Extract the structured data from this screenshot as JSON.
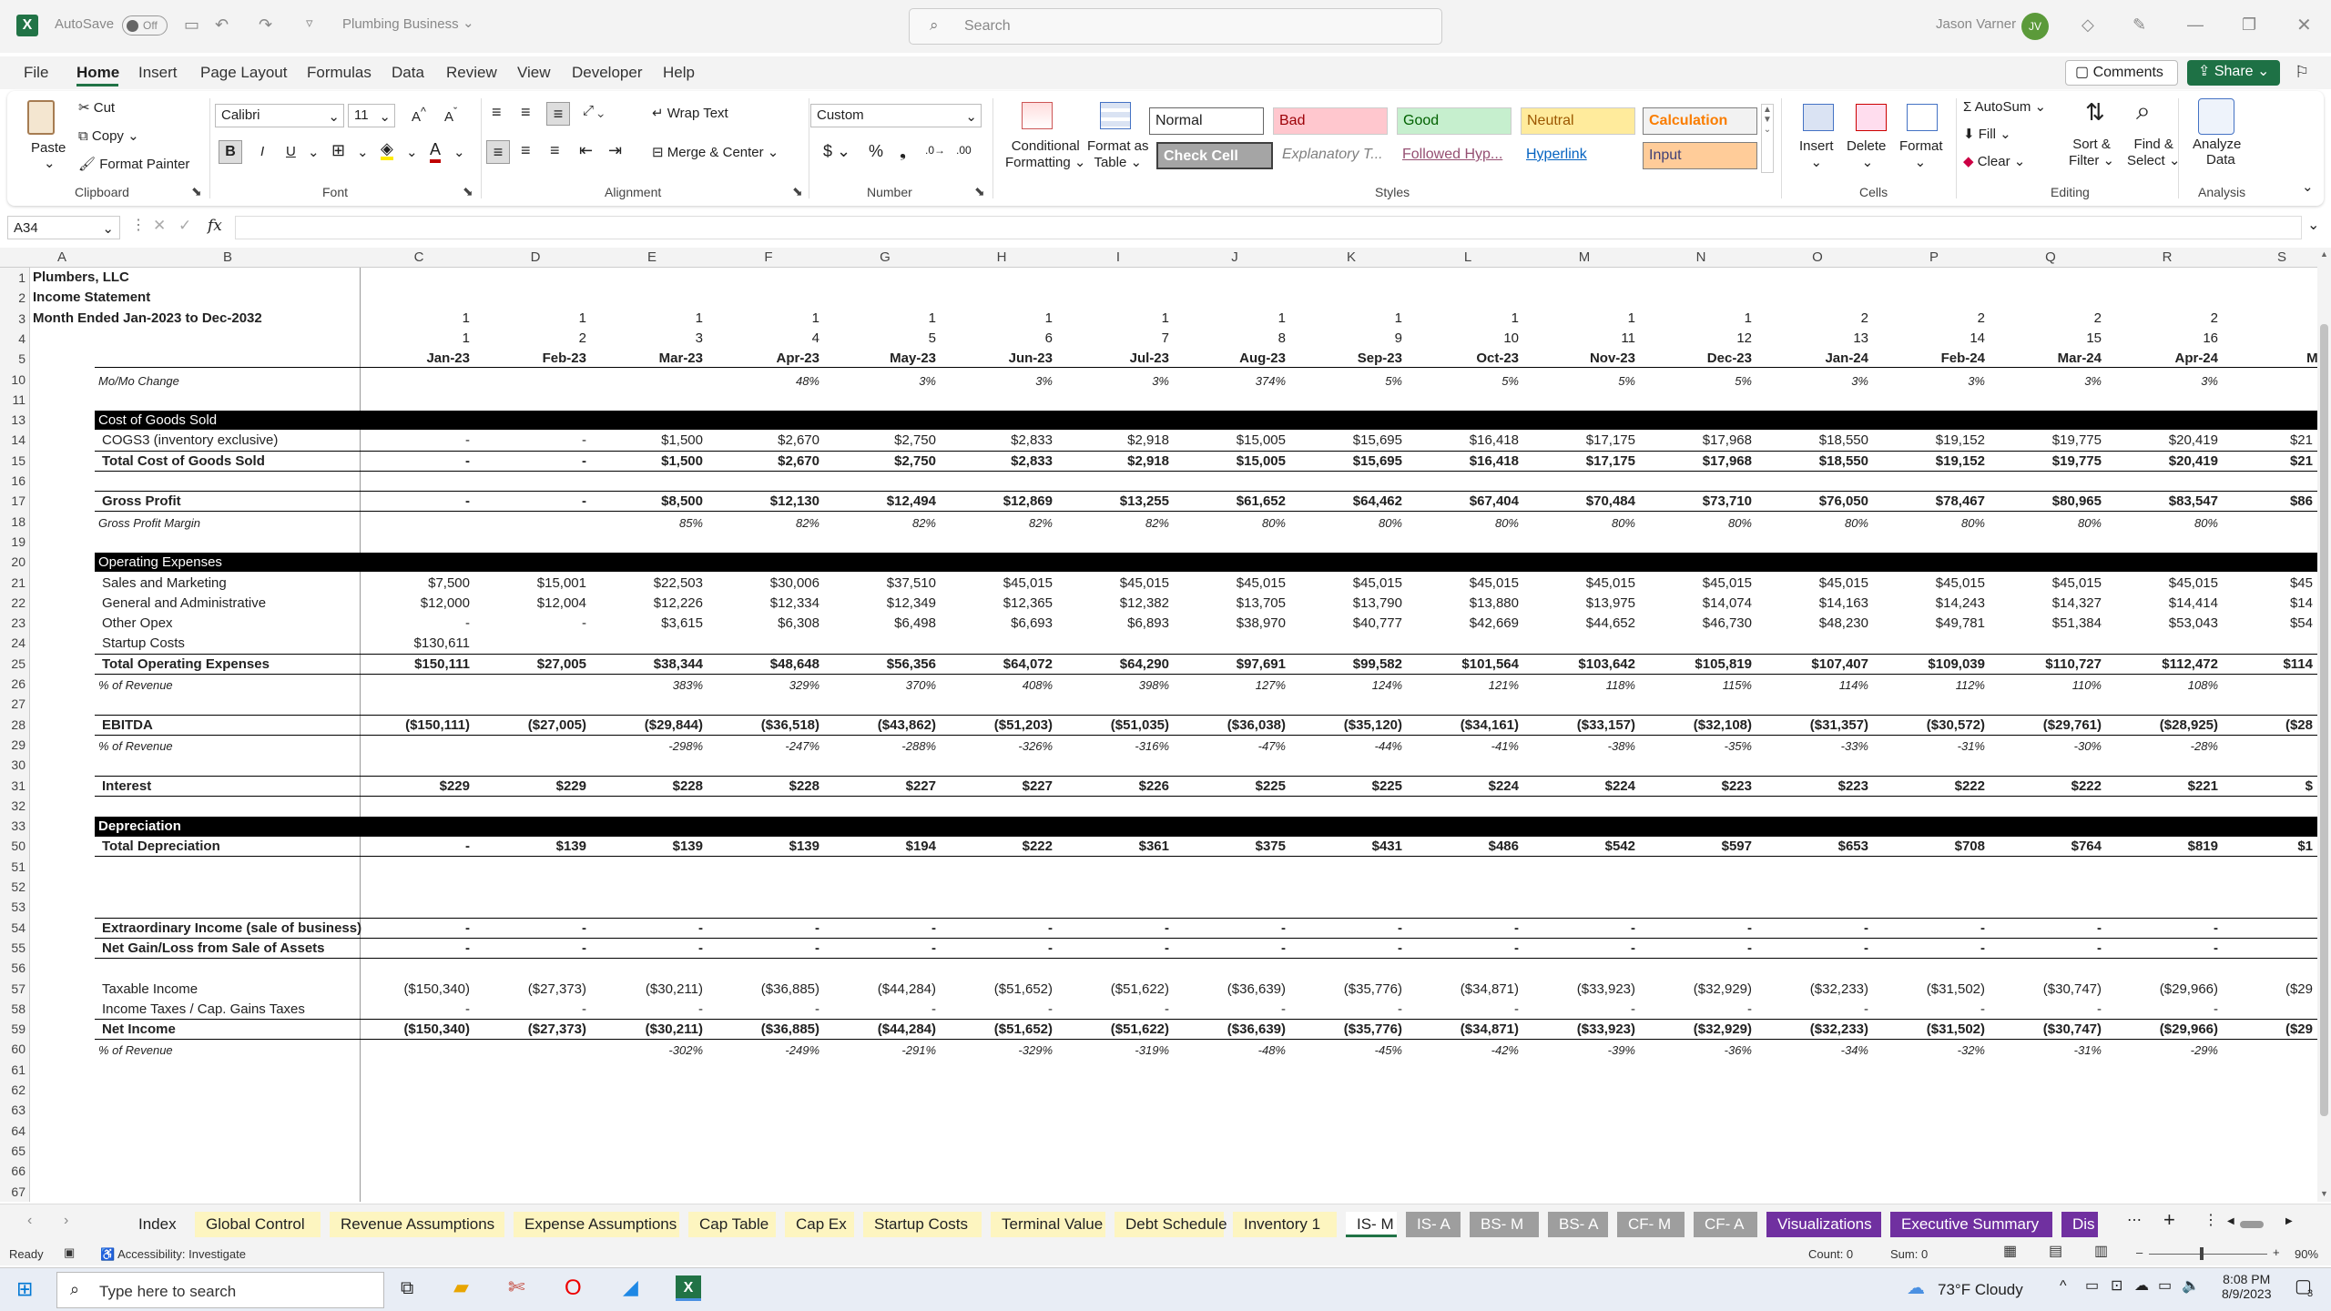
{
  "titlebar": {
    "autosave": "AutoSave",
    "autosave_state": "Off",
    "file_name": "Plumbing Business",
    "search_placeholder": "Search",
    "user": "Jason Varner",
    "initials": "JV"
  },
  "menu": [
    "File",
    "Home",
    "Insert",
    "Page Layout",
    "Formulas",
    "Data",
    "Review",
    "View",
    "Developer",
    "Help"
  ],
  "menu_buttons": {
    "comments": "Comments",
    "share": "Share"
  },
  "ribbon": {
    "clipboard": {
      "paste": "Paste",
      "cut": "Cut",
      "copy": "Copy",
      "format_painter": "Format Painter",
      "group": "Clipboard"
    },
    "font": {
      "name": "Calibri",
      "size": "11",
      "group": "Font"
    },
    "alignment": {
      "wrap": "Wrap Text",
      "merge": "Merge & Center",
      "group": "Alignment"
    },
    "number": {
      "format": "Custom",
      "group": "Number"
    },
    "styles": {
      "cond": "Conditional",
      "cond2": "Formatting",
      "fmt_table": "Format as",
      "fmt_table2": "Table",
      "group": "Styles",
      "cells": [
        "Normal",
        "Bad",
        "Good",
        "Neutral",
        "Calculation",
        "Check Cell",
        "Explanatory T...",
        "Followed Hyp...",
        "Hyperlink",
        "Input"
      ]
    },
    "cells": {
      "insert": "Insert",
      "delete": "Delete",
      "format": "Format",
      "group": "Cells"
    },
    "editing": {
      "autosum": "AutoSum",
      "fill": "Fill",
      "clear": "Clear",
      "sort": "Sort &",
      "sort2": "Filter",
      "find": "Find &",
      "find2": "Select",
      "group": "Editing"
    },
    "analysis": {
      "analyze": "Analyze",
      "analyze2": "Data",
      "group": "Analysis"
    }
  },
  "formula_bar": {
    "name_box": "A34",
    "fx": "fx",
    "formula": ""
  },
  "columns": [
    "A",
    "B",
    "C",
    "D",
    "E",
    "F",
    "G",
    "H",
    "I",
    "J",
    "K",
    "L",
    "M",
    "N",
    "O",
    "P",
    "Q",
    "R",
    "S"
  ],
  "row_numbers": [
    "1",
    "2",
    "3",
    "4",
    "5",
    "10",
    "11",
    "13",
    "14",
    "15",
    "16",
    "17",
    "18",
    "19",
    "20",
    "21",
    "22",
    "23",
    "24",
    "25",
    "26",
    "27",
    "28",
    "29",
    "30",
    "31",
    "32",
    "33",
    "50",
    "51",
    "52",
    "53",
    "54",
    "55",
    "56",
    "57",
    "58",
    "59",
    "60",
    "61",
    "62",
    "63",
    "64",
    "65",
    "66",
    "67"
  ],
  "sheet": {
    "a1": "Plumbers, LLC",
    "a2": "Income Statement",
    "a3": "Month Ended Jan-2023 to Dec-2032",
    "row3": [
      "1",
      "1",
      "1",
      "1",
      "1",
      "1",
      "1",
      "1",
      "1",
      "1",
      "1",
      "1",
      "2",
      "2",
      "2",
      "2"
    ],
    "row4": [
      "1",
      "2",
      "3",
      "4",
      "5",
      "6",
      "7",
      "8",
      "9",
      "10",
      "11",
      "12",
      "13",
      "14",
      "15",
      "16"
    ],
    "months": [
      "Jan-23",
      "Feb-23",
      "Mar-23",
      "Apr-23",
      "May-23",
      "Jun-23",
      "Jul-23",
      "Aug-23",
      "Sep-23",
      "Oct-23",
      "Nov-23",
      "Dec-23",
      "Jan-24",
      "Feb-24",
      "Mar-24",
      "Apr-24",
      "Ma"
    ],
    "rows": [
      {
        "r": "10",
        "label": "Mo/Mo Change",
        "style": "i",
        "vals": [
          "",
          "",
          "",
          "48%",
          "3%",
          "3%",
          "3%",
          "374%",
          "5%",
          "5%",
          "5%",
          "5%",
          "3%",
          "3%",
          "3%",
          "3%",
          ""
        ]
      },
      {
        "r": "13",
        "label": "Cost of Goods Sold",
        "style": "hdr",
        "vals": []
      },
      {
        "r": "14",
        "label": "COGS3 (inventory exclusive)",
        "style": "n",
        "vals": [
          "-",
          "-",
          "$1,500",
          "$2,670",
          "$2,750",
          "$2,833",
          "$2,918",
          "$15,005",
          "$15,695",
          "$16,418",
          "$17,175",
          "$17,968",
          "$18,550",
          "$19,152",
          "$19,775",
          "$20,419",
          "$21"
        ]
      },
      {
        "r": "15",
        "label": "Total Cost of Goods Sold",
        "style": "b",
        "vals": [
          "-",
          "-",
          "$1,500",
          "$2,670",
          "$2,750",
          "$2,833",
          "$2,918",
          "$15,005",
          "$15,695",
          "$16,418",
          "$17,175",
          "$17,968",
          "$18,550",
          "$19,152",
          "$19,775",
          "$20,419",
          "$21"
        ]
      },
      {
        "r": "17",
        "label": "Gross Profit",
        "style": "b",
        "vals": [
          "-",
          "-",
          "$8,500",
          "$12,130",
          "$12,494",
          "$12,869",
          "$13,255",
          "$61,652",
          "$64,462",
          "$67,404",
          "$70,484",
          "$73,710",
          "$76,050",
          "$78,467",
          "$80,965",
          "$83,547",
          "$86"
        ]
      },
      {
        "r": "18",
        "label": "Gross Profit Margin",
        "style": "i",
        "vals": [
          "",
          "",
          "85%",
          "82%",
          "82%",
          "82%",
          "82%",
          "80%",
          "80%",
          "80%",
          "80%",
          "80%",
          "80%",
          "80%",
          "80%",
          "80%",
          ""
        ]
      },
      {
        "r": "20",
        "label": "Operating Expenses",
        "style": "hdr",
        "vals": []
      },
      {
        "r": "21",
        "label": "Sales and Marketing",
        "style": "n",
        "vals": [
          "$7,500",
          "$15,001",
          "$22,503",
          "$30,006",
          "$37,510",
          "$45,015",
          "$45,015",
          "$45,015",
          "$45,015",
          "$45,015",
          "$45,015",
          "$45,015",
          "$45,015",
          "$45,015",
          "$45,015",
          "$45,015",
          "$45"
        ]
      },
      {
        "r": "22",
        "label": "General and Administrative",
        "style": "n",
        "vals": [
          "$12,000",
          "$12,004",
          "$12,226",
          "$12,334",
          "$12,349",
          "$12,365",
          "$12,382",
          "$13,705",
          "$13,790",
          "$13,880",
          "$13,975",
          "$14,074",
          "$14,163",
          "$14,243",
          "$14,327",
          "$14,414",
          "$14"
        ]
      },
      {
        "r": "23",
        "label": "Other Opex",
        "style": "n",
        "vals": [
          "-",
          "-",
          "$3,615",
          "$6,308",
          "$6,498",
          "$6,693",
          "$6,893",
          "$38,970",
          "$40,777",
          "$42,669",
          "$44,652",
          "$46,730",
          "$48,230",
          "$49,781",
          "$51,384",
          "$53,043",
          "$54"
        ]
      },
      {
        "r": "24",
        "label": "Startup Costs",
        "style": "n",
        "vals": [
          "$130,611",
          "",
          "",
          "",
          "",
          "",
          "",
          "",
          "",
          "",
          "",
          "",
          "",
          "",
          "",
          "",
          ""
        ]
      },
      {
        "r": "25",
        "label": "Total Operating Expenses",
        "style": "b",
        "vals": [
          "$150,111",
          "$27,005",
          "$38,344",
          "$48,648",
          "$56,356",
          "$64,072",
          "$64,290",
          "$97,691",
          "$99,582",
          "$101,564",
          "$103,642",
          "$105,819",
          "$107,407",
          "$109,039",
          "$110,727",
          "$112,472",
          "$114"
        ]
      },
      {
        "r": "26",
        "label": "% of Revenue",
        "style": "i",
        "vals": [
          "",
          "",
          "383%",
          "329%",
          "370%",
          "408%",
          "398%",
          "127%",
          "124%",
          "121%",
          "118%",
          "115%",
          "114%",
          "112%",
          "110%",
          "108%",
          ""
        ]
      },
      {
        "r": "28",
        "label": "EBITDA",
        "style": "b",
        "vals": [
          "($150,111)",
          "($27,005)",
          "($29,844)",
          "($36,518)",
          "($43,862)",
          "($51,203)",
          "($51,035)",
          "($36,038)",
          "($35,120)",
          "($34,161)",
          "($33,157)",
          "($32,108)",
          "($31,357)",
          "($30,572)",
          "($29,761)",
          "($28,925)",
          "($28"
        ]
      },
      {
        "r": "29",
        "label": "% of Revenue",
        "style": "i",
        "vals": [
          "",
          "",
          "-298%",
          "-247%",
          "-288%",
          "-326%",
          "-316%",
          "-47%",
          "-44%",
          "-41%",
          "-38%",
          "-35%",
          "-33%",
          "-31%",
          "-30%",
          "-28%",
          ""
        ]
      },
      {
        "r": "31",
        "label": "Interest",
        "style": "b",
        "vals": [
          "$229",
          "$229",
          "$228",
          "$228",
          "$227",
          "$227",
          "$226",
          "$225",
          "$225",
          "$224",
          "$224",
          "$223",
          "$223",
          "$222",
          "$222",
          "$221",
          "$"
        ]
      },
      {
        "r": "33",
        "label": "Depreciation",
        "style": "hdr",
        "vals": []
      },
      {
        "r": "50",
        "label": "Total Depreciation",
        "style": "b",
        "vals": [
          "-",
          "$139",
          "$139",
          "$139",
          "$194",
          "$222",
          "$361",
          "$375",
          "$431",
          "$486",
          "$542",
          "$597",
          "$653",
          "$708",
          "$764",
          "$819",
          "$1"
        ]
      },
      {
        "r": "54",
        "label": "Extraordinary Income (sale of business)",
        "style": "b",
        "vals": [
          "-",
          "-",
          "-",
          "-",
          "-",
          "-",
          "-",
          "-",
          "-",
          "-",
          "-",
          "-",
          "-",
          "-",
          "-",
          "-",
          ""
        ]
      },
      {
        "r": "55",
        "label": "Net Gain/Loss from Sale of Assets",
        "style": "b",
        "vals": [
          "-",
          "-",
          "-",
          "-",
          "-",
          "-",
          "-",
          "-",
          "-",
          "-",
          "-",
          "-",
          "-",
          "-",
          "-",
          "-",
          ""
        ]
      },
      {
        "r": "57",
        "label": "Taxable Income",
        "style": "n",
        "vals": [
          "($150,340)",
          "($27,373)",
          "($30,211)",
          "($36,885)",
          "($44,284)",
          "($51,652)",
          "($51,622)",
          "($36,639)",
          "($35,776)",
          "($34,871)",
          "($33,923)",
          "($32,929)",
          "($32,233)",
          "($31,502)",
          "($30,747)",
          "($29,966)",
          "($29"
        ]
      },
      {
        "r": "58",
        "label": "Income Taxes / Cap. Gains Taxes",
        "style": "n",
        "vals": [
          "-",
          "-",
          "-",
          "-",
          "-",
          "-",
          "-",
          "-",
          "-",
          "-",
          "-",
          "-",
          "-",
          "-",
          "-",
          "-",
          ""
        ]
      },
      {
        "r": "59",
        "label": "Net Income",
        "style": "b",
        "vals": [
          "($150,340)",
          "($27,373)",
          "($30,211)",
          "($36,885)",
          "($44,284)",
          "($51,652)",
          "($51,622)",
          "($36,639)",
          "($35,776)",
          "($34,871)",
          "($33,923)",
          "($32,929)",
          "($32,233)",
          "($31,502)",
          "($30,747)",
          "($29,966)",
          "($29"
        ]
      },
      {
        "r": "60",
        "label": "% of Revenue",
        "style": "i",
        "vals": [
          "",
          "",
          "-302%",
          "-249%",
          "-291%",
          "-329%",
          "-319%",
          "-48%",
          "-45%",
          "-42%",
          "-39%",
          "-36%",
          "-34%",
          "-32%",
          "-31%",
          "-29%",
          ""
        ]
      }
    ]
  },
  "sheet_tabs": [
    {
      "label": "Index",
      "color": "#f3f3f3",
      "fg": "#222"
    },
    {
      "label": "Global Control",
      "color": "#fdf5c0",
      "fg": "#222"
    },
    {
      "label": "Revenue Assumptions",
      "color": "#fdf5c0",
      "fg": "#222"
    },
    {
      "label": "Expense Assumptions",
      "color": "#fdf5c0",
      "fg": "#222"
    },
    {
      "label": "Cap Table",
      "color": "#fdf5c0",
      "fg": "#222"
    },
    {
      "label": "Cap Ex",
      "color": "#fdf5c0",
      "fg": "#222"
    },
    {
      "label": "Startup Costs",
      "color": "#fdf5c0",
      "fg": "#222"
    },
    {
      "label": "Terminal Value",
      "color": "#fdf5c0",
      "fg": "#222"
    },
    {
      "label": "Debt Schedule",
      "color": "#fdf5c0",
      "fg": "#222"
    },
    {
      "label": "Inventory 1",
      "color": "#fdf5c0",
      "fg": "#222"
    },
    {
      "label": "IS- M",
      "color": "#ffffff",
      "fg": "#222"
    },
    {
      "label": "IS- A",
      "color": "#9e9e9e",
      "fg": "#fff"
    },
    {
      "label": "BS- M",
      "color": "#9e9e9e",
      "fg": "#fff"
    },
    {
      "label": "BS- A",
      "color": "#9e9e9e",
      "fg": "#fff"
    },
    {
      "label": "CF- M",
      "color": "#9e9e9e",
      "fg": "#fff"
    },
    {
      "label": "CF- A",
      "color": "#9e9e9e",
      "fg": "#fff"
    },
    {
      "label": "Visualizations",
      "color": "#7030a0",
      "fg": "#fff"
    },
    {
      "label": "Executive Summary",
      "color": "#7030a0",
      "fg": "#fff"
    },
    {
      "label": "Dis",
      "color": "#7030a0",
      "fg": "#fff"
    }
  ],
  "status": {
    "ready": "Ready",
    "accessibility": "Accessibility: Investigate",
    "count": "Count: 0",
    "sum": "Sum: 0",
    "zoom": "90%"
  },
  "taskbar": {
    "search_placeholder": "Type here to search",
    "weather": "73°F  Cloudy",
    "time": "8:08 PM",
    "date": "8/9/2023",
    "notif": "3"
  },
  "colors": {
    "excel_green": "#217346",
    "share_green": "#1e7145",
    "accent_purple": "#7030a0"
  }
}
